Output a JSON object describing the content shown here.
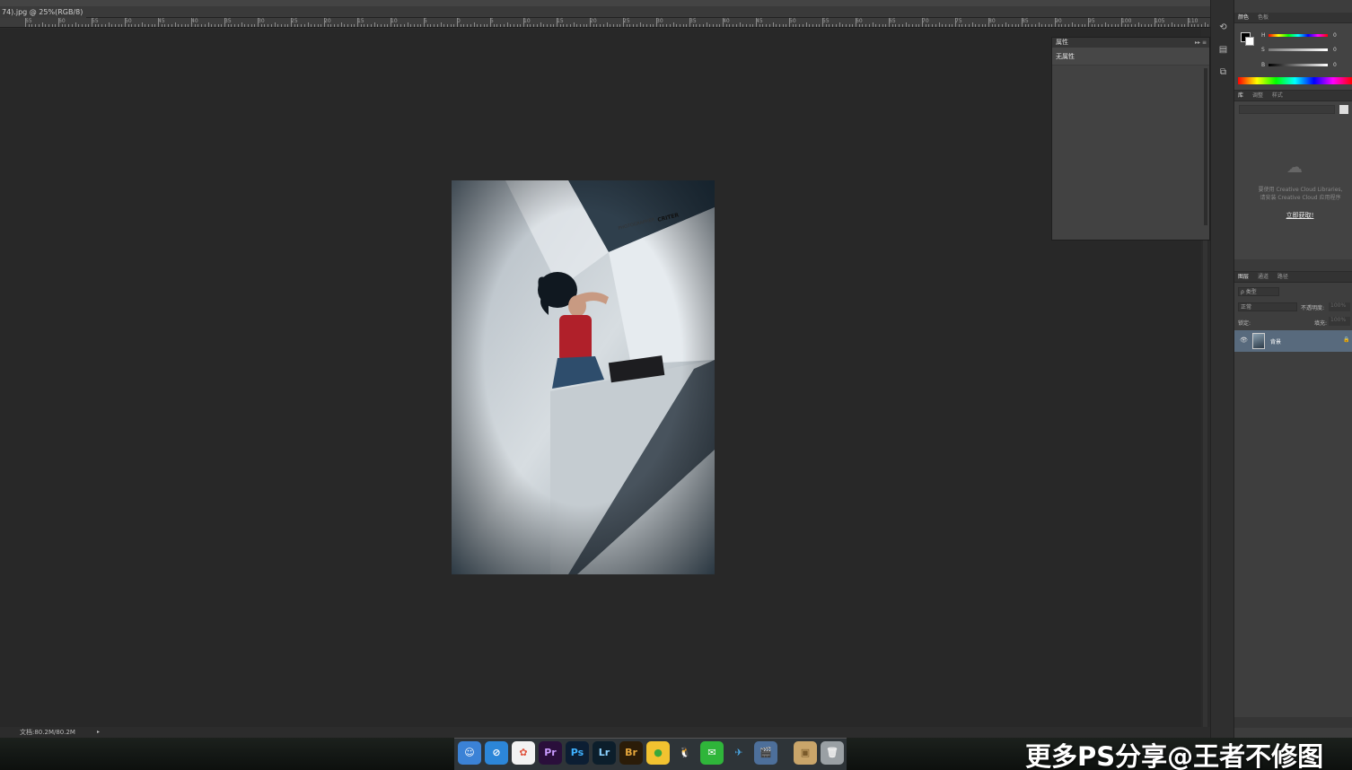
{
  "document": {
    "tab_title": "74).jpg @ 25%(RGB/8)",
    "status_text": "文档:80.2M/80.2M",
    "status_arrow": "▸",
    "photo_watermark_line1": "PHOTOGRAPHER",
    "photo_watermark_line2": "CRITER"
  },
  "ruler": {
    "labels": [
      "65",
      "60",
      "55",
      "50",
      "45",
      "40",
      "35",
      "30",
      "25",
      "20",
      "15",
      "10",
      "5",
      "0",
      "5",
      "10",
      "15",
      "20",
      "25",
      "30",
      "35",
      "40",
      "45",
      "50",
      "55",
      "60",
      "65",
      "70",
      "75",
      "80",
      "85",
      "90",
      "95",
      "100",
      "105",
      "110"
    ]
  },
  "properties_panel": {
    "title": "属性",
    "controls": "▸▸  ≡",
    "subtitle": "无属性"
  },
  "color_panel": {
    "tabs": [
      "颜色",
      "色板"
    ],
    "sliders": [
      {
        "label": "H",
        "value": "0"
      },
      {
        "label": "S",
        "value": "0"
      },
      {
        "label": "B",
        "value": "0"
      }
    ]
  },
  "library_panel": {
    "tabs": [
      "库",
      "调整",
      "样式"
    ],
    "message_line1": "要使用 Creative Cloud Libraries,",
    "message_line2": "请安装 Creative Cloud 应用程序",
    "link": "立即获取!"
  },
  "layers_panel": {
    "tabs": [
      "图层",
      "通道",
      "路径"
    ],
    "kind": "ρ 类型",
    "blend_mode": "正常",
    "opacity_label": "不透明度:",
    "opacity_value": "100%",
    "lock_label": "锁定:",
    "fill_label": "填充:",
    "fill_value": "100%",
    "layer_name": "背景"
  },
  "dock": {
    "apps": [
      {
        "name": "finder-icon",
        "label": "☺",
        "bg": "#3b82d6",
        "fg": "#fff"
      },
      {
        "name": "safari-icon",
        "label": "⊘",
        "bg": "#2c86d8",
        "fg": "#fff"
      },
      {
        "name": "photos-icon",
        "label": "✿",
        "bg": "#f2f2f2",
        "fg": "#e0533d"
      },
      {
        "name": "premiere-icon",
        "label": "Pr",
        "bg": "#2a0f3b",
        "fg": "#c99cff"
      },
      {
        "name": "photoshop-icon",
        "label": "Ps",
        "bg": "#0c1e33",
        "fg": "#3fb1ff"
      },
      {
        "name": "lightroom-icon",
        "label": "Lr",
        "bg": "#0c1e2b",
        "fg": "#8cd2ff"
      },
      {
        "name": "bridge-icon",
        "label": "Br",
        "bg": "#2b1c08",
        "fg": "#e6a73c"
      },
      {
        "name": "chrome-like-icon",
        "label": "●",
        "bg": "#f2c230",
        "fg": "#3aa83a"
      },
      {
        "name": "qq-icon",
        "label": "🐧",
        "bg": "#2e3438",
        "fg": "#fff"
      },
      {
        "name": "wechat-icon",
        "label": "✉",
        "bg": "#2fb53a",
        "fg": "#fff"
      },
      {
        "name": "bird-icon",
        "label": "✈",
        "bg": "#2e3438",
        "fg": "#4aa9e8"
      },
      {
        "name": "video-icon",
        "label": "🎬",
        "bg": "#4d6f9a",
        "fg": "#fff"
      },
      {
        "name": "box-icon",
        "label": "▣",
        "bg": "#c9a56a",
        "fg": "#7a5a2a"
      },
      {
        "name": "trash-icon",
        "label": "🗑",
        "bg": "#9aa0a4",
        "fg": "#eee"
      }
    ]
  },
  "overlay": {
    "watermark": "更多PS分享@王者不修图"
  },
  "colors": {
    "layer_selected": "#586a7d",
    "workspace": "#282828"
  }
}
